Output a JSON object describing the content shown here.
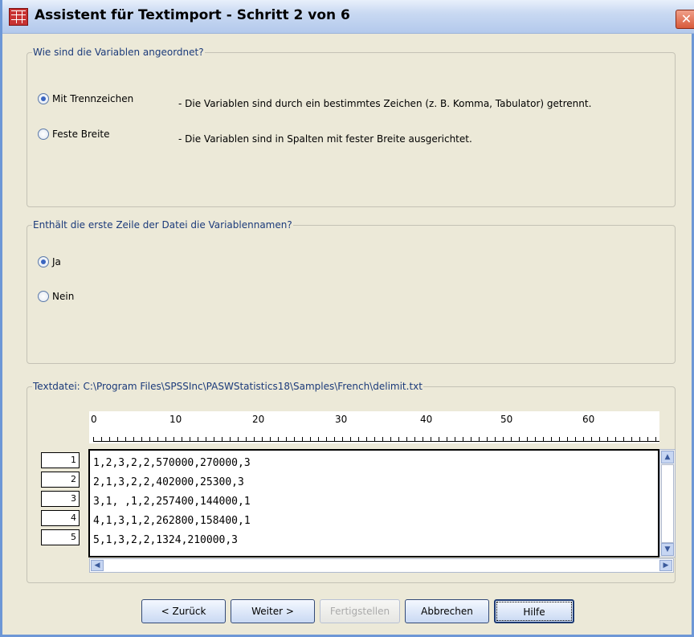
{
  "window": {
    "title": "Assistent für Textimport - Schritt 2 von 6",
    "close_glyph": "✕"
  },
  "group1": {
    "legend": "Wie sind die Variablen angeordnet?",
    "options": [
      {
        "label": "Mit Trennzeichen",
        "description": "- Die Variablen sind durch ein bestimmtes Zeichen (z. B. Komma, Tabulator) getrennt.",
        "checked": true
      },
      {
        "label": "Feste Breite",
        "description": "- Die Variablen sind in Spalten mit fester Breite ausgerichtet.",
        "checked": false
      }
    ]
  },
  "group2": {
    "legend": "Enthält die erste Zeile der Datei die Variablennamen?",
    "options": [
      {
        "label": "Ja",
        "checked": true
      },
      {
        "label": "Nein",
        "checked": false
      }
    ]
  },
  "group3": {
    "legend": "Textdatei: C:\\Program Files\\SPSSInc\\PASWStatistics18\\Samples\\French\\delimit.txt",
    "ruler_labels": [
      "0",
      "10",
      "20",
      "30",
      "40",
      "50",
      "60"
    ],
    "row_numbers": [
      "1",
      "2",
      "3",
      "4",
      "5"
    ],
    "lines": [
      "1,2,3,2,2,570000,270000,3",
      "2,1,3,2,2,402000,25300,3",
      "3,1, ,1,2,257400,144000,1",
      "4,1,3,1,2,262800,158400,1",
      "5,1,3,2,2,1324,210000,3"
    ]
  },
  "buttons": {
    "back": "< Zurück",
    "next": "Weiter >",
    "finish": "Fertigstellen",
    "cancel": "Abbrechen",
    "help": "Hilfe"
  },
  "icons": {
    "app": "table-grid-icon",
    "close": "close-icon",
    "scroll_up": "arrow-up-icon",
    "scroll_down": "arrow-down-icon",
    "scroll_left": "arrow-left-icon",
    "scroll_right": "arrow-right-icon"
  },
  "colors": {
    "title_gradient_top": "#e8f0fb",
    "dialog_background": "#ece9d8",
    "legend_text": "#1b3a7a",
    "close_button": "#d85a3a"
  }
}
